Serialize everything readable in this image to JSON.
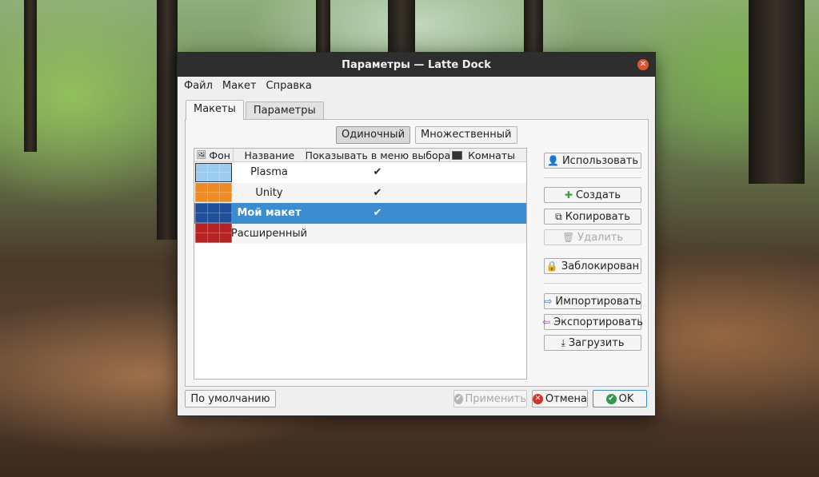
{
  "window": {
    "title": "Параметры — Latte Dock"
  },
  "menubar": {
    "items": [
      "Файл",
      "Макет",
      "Справка"
    ]
  },
  "tabs": [
    {
      "label": "Макеты"
    },
    {
      "label": "Параметры"
    }
  ],
  "mode_toggle": {
    "single": "Одиночный",
    "multiple": "Множественный",
    "selected": "Одиночный"
  },
  "table": {
    "headers": {
      "background": "Фон",
      "name": "Название",
      "show_in_menu": "Показывать в меню выбора",
      "rooms": "Комнаты"
    },
    "rows": [
      {
        "name": "Plasma",
        "show_in_menu": "✔",
        "color": "#9ccbf0"
      },
      {
        "name": "Unity",
        "show_in_menu": "✔",
        "color": "#f08a22"
      },
      {
        "name": "Мой макет",
        "show_in_menu": "✔",
        "color": "#1f4f9a",
        "selected": true
      },
      {
        "name": "Расширенный",
        "show_in_menu": "",
        "color": "#b52424"
      }
    ]
  },
  "side_buttons": {
    "use": "Использовать",
    "create": "Создать",
    "copy": "Копировать",
    "remove": "Удалить",
    "locked": "Заблокирован",
    "import": "Импортировать",
    "export": "Экспортировать",
    "download": "Загрузить"
  },
  "footer": {
    "defaults": "По умолчанию",
    "apply": "Применить",
    "cancel": "Отмена",
    "ok": "OK"
  },
  "colors": {
    "accent": "#3b8dd0",
    "titlebar": "#2e2e2e",
    "close": "#e0532d"
  }
}
